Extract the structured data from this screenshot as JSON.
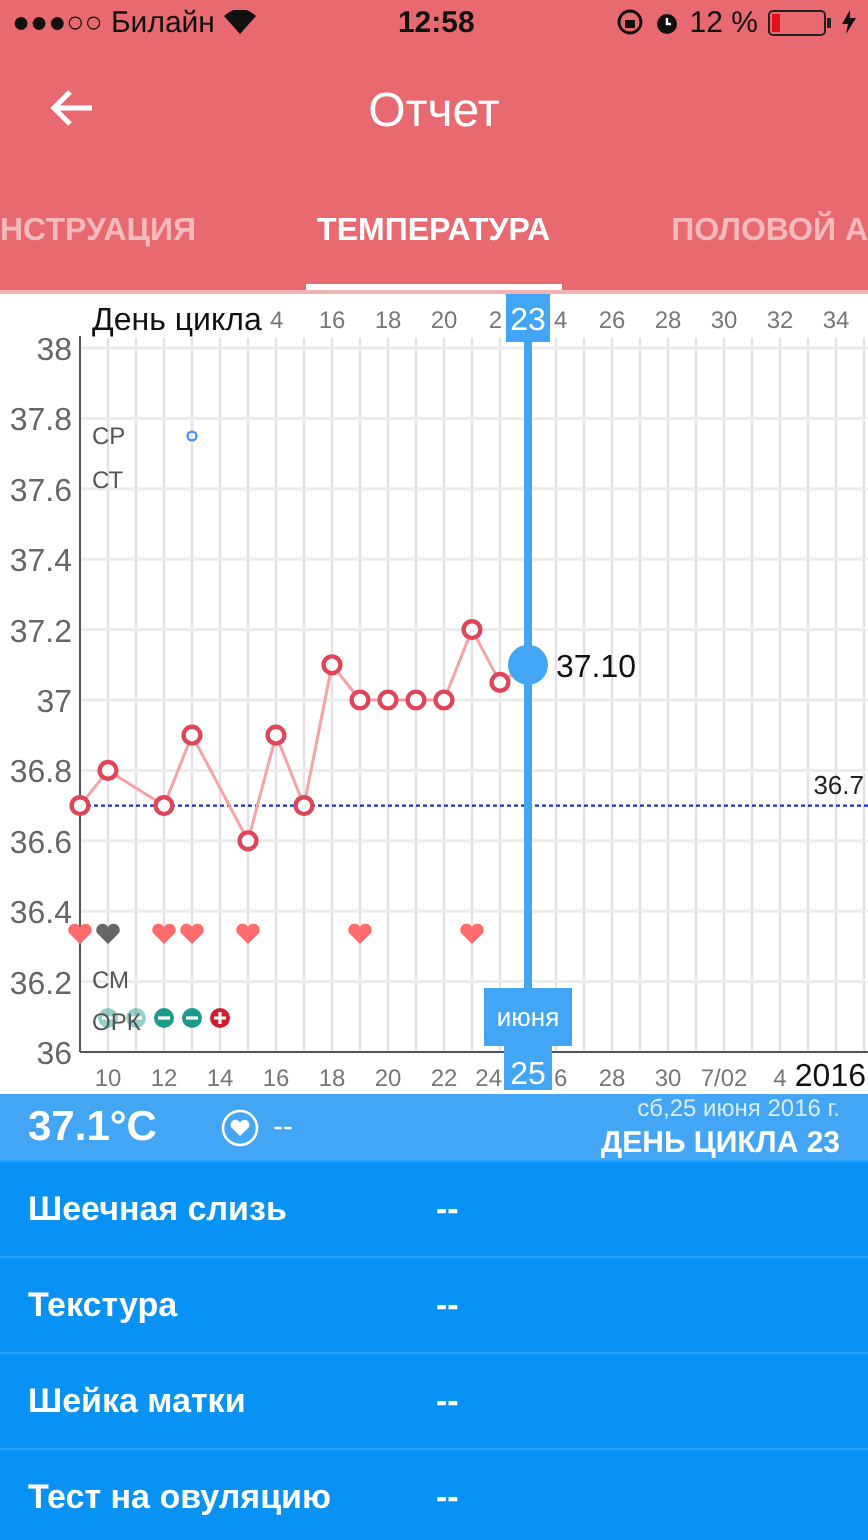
{
  "status_bar": {
    "carrier": "●●●○○ Билайн",
    "time": "12:58",
    "battery": "12 %"
  },
  "header": {
    "title": "Отчет"
  },
  "tabs": [
    {
      "label": "НСТРУАЦИЯ",
      "selected": false
    },
    {
      "label": "ТЕМПЕРАТУРА",
      "selected": true
    },
    {
      "label": "ПОЛОВОЙ А",
      "selected": false
    }
  ],
  "chart": {
    "cycle_day_label": "День цикла",
    "cycle_day_ticks": [
      "4",
      "16",
      "18",
      "20",
      "2",
      "4",
      "26",
      "28",
      "30",
      "32",
      "34"
    ],
    "date_extra_ticks": [
      "24",
      "6",
      "7/02",
      "4"
    ],
    "selected_day": "23",
    "selected_month": "июня",
    "selected_date": "25",
    "selected_value": "37.10",
    "year": "2016",
    "row_labels": [
      "СР",
      "СТ",
      "СМ",
      "ОРК"
    ],
    "days": [
      {
        "color": "#ff6b6b",
        "kind": "none"
      },
      {
        "color": "#666666",
        "kind": "negative"
      },
      {
        "kind": "negative"
      },
      {
        "color": "#ff6b6b",
        "kind": "negative"
      },
      {
        "color": "#ff6b6b",
        "kind": "negative",
        "cervical": {
          "color": "#4a8ff0"
        }
      },
      {
        "kind": "positive"
      },
      {
        "color": "#ff6b6b",
        "kind": "none"
      },
      {
        "kind": "none"
      },
      {
        "kind": "none"
      },
      {
        "kind": "none"
      },
      {
        "color": "#ff6b6b",
        "kind": "none"
      },
      {
        "kind": "none"
      },
      {
        "kind": "none"
      },
      {
        "kind": "none"
      },
      {
        "color": "#ff6b6b",
        "kind": "none"
      }
    ],
    "chart_data": {
      "type": "line",
      "grid": true,
      "x": [
        9,
        10,
        12,
        13,
        15,
        16,
        17,
        18,
        19,
        20,
        21,
        22,
        23,
        24,
        25
      ],
      "series": [
        {
          "color": "#e0455a",
          "marker": "o",
          "values": [
            36.7,
            36.8,
            36.7,
            36.9,
            36.6,
            36.9,
            36.7,
            37.1,
            37.0,
            37.0,
            37.0,
            37.0,
            37.2,
            37.05,
            37.1
          ]
        }
      ],
      "xlim": [
        9,
        37
      ],
      "ylim": [
        36,
        38
      ],
      "xticks": [
        10,
        12,
        14,
        16,
        18,
        20,
        22,
        28,
        30
      ],
      "yticks": [
        36,
        36.2,
        36.4,
        36.6,
        36.8,
        37,
        37.2,
        37.4,
        37.6,
        37.8,
        38
      ],
      "ref_lines": [
        {
          "axis": "y",
          "value": 36.7,
          "label": "36.7",
          "color": "#1d2de0"
        },
        {
          "axis": "x",
          "value": 25,
          "color": "#42a6f5"
        }
      ]
    }
  },
  "summary": {
    "temperature": "37.1°C",
    "intercourse": "--",
    "date": "сб,25 июня 2016 г.",
    "cycle_day": "ДЕНЬ ЦИКЛА 23"
  },
  "details": [
    {
      "label": "Шеечная слизь",
      "value": "--"
    },
    {
      "label": "Текстура",
      "value": "--"
    },
    {
      "label": "Шейка матки",
      "value": "--"
    },
    {
      "label": "Тест на овуляцию",
      "value": "--"
    }
  ]
}
